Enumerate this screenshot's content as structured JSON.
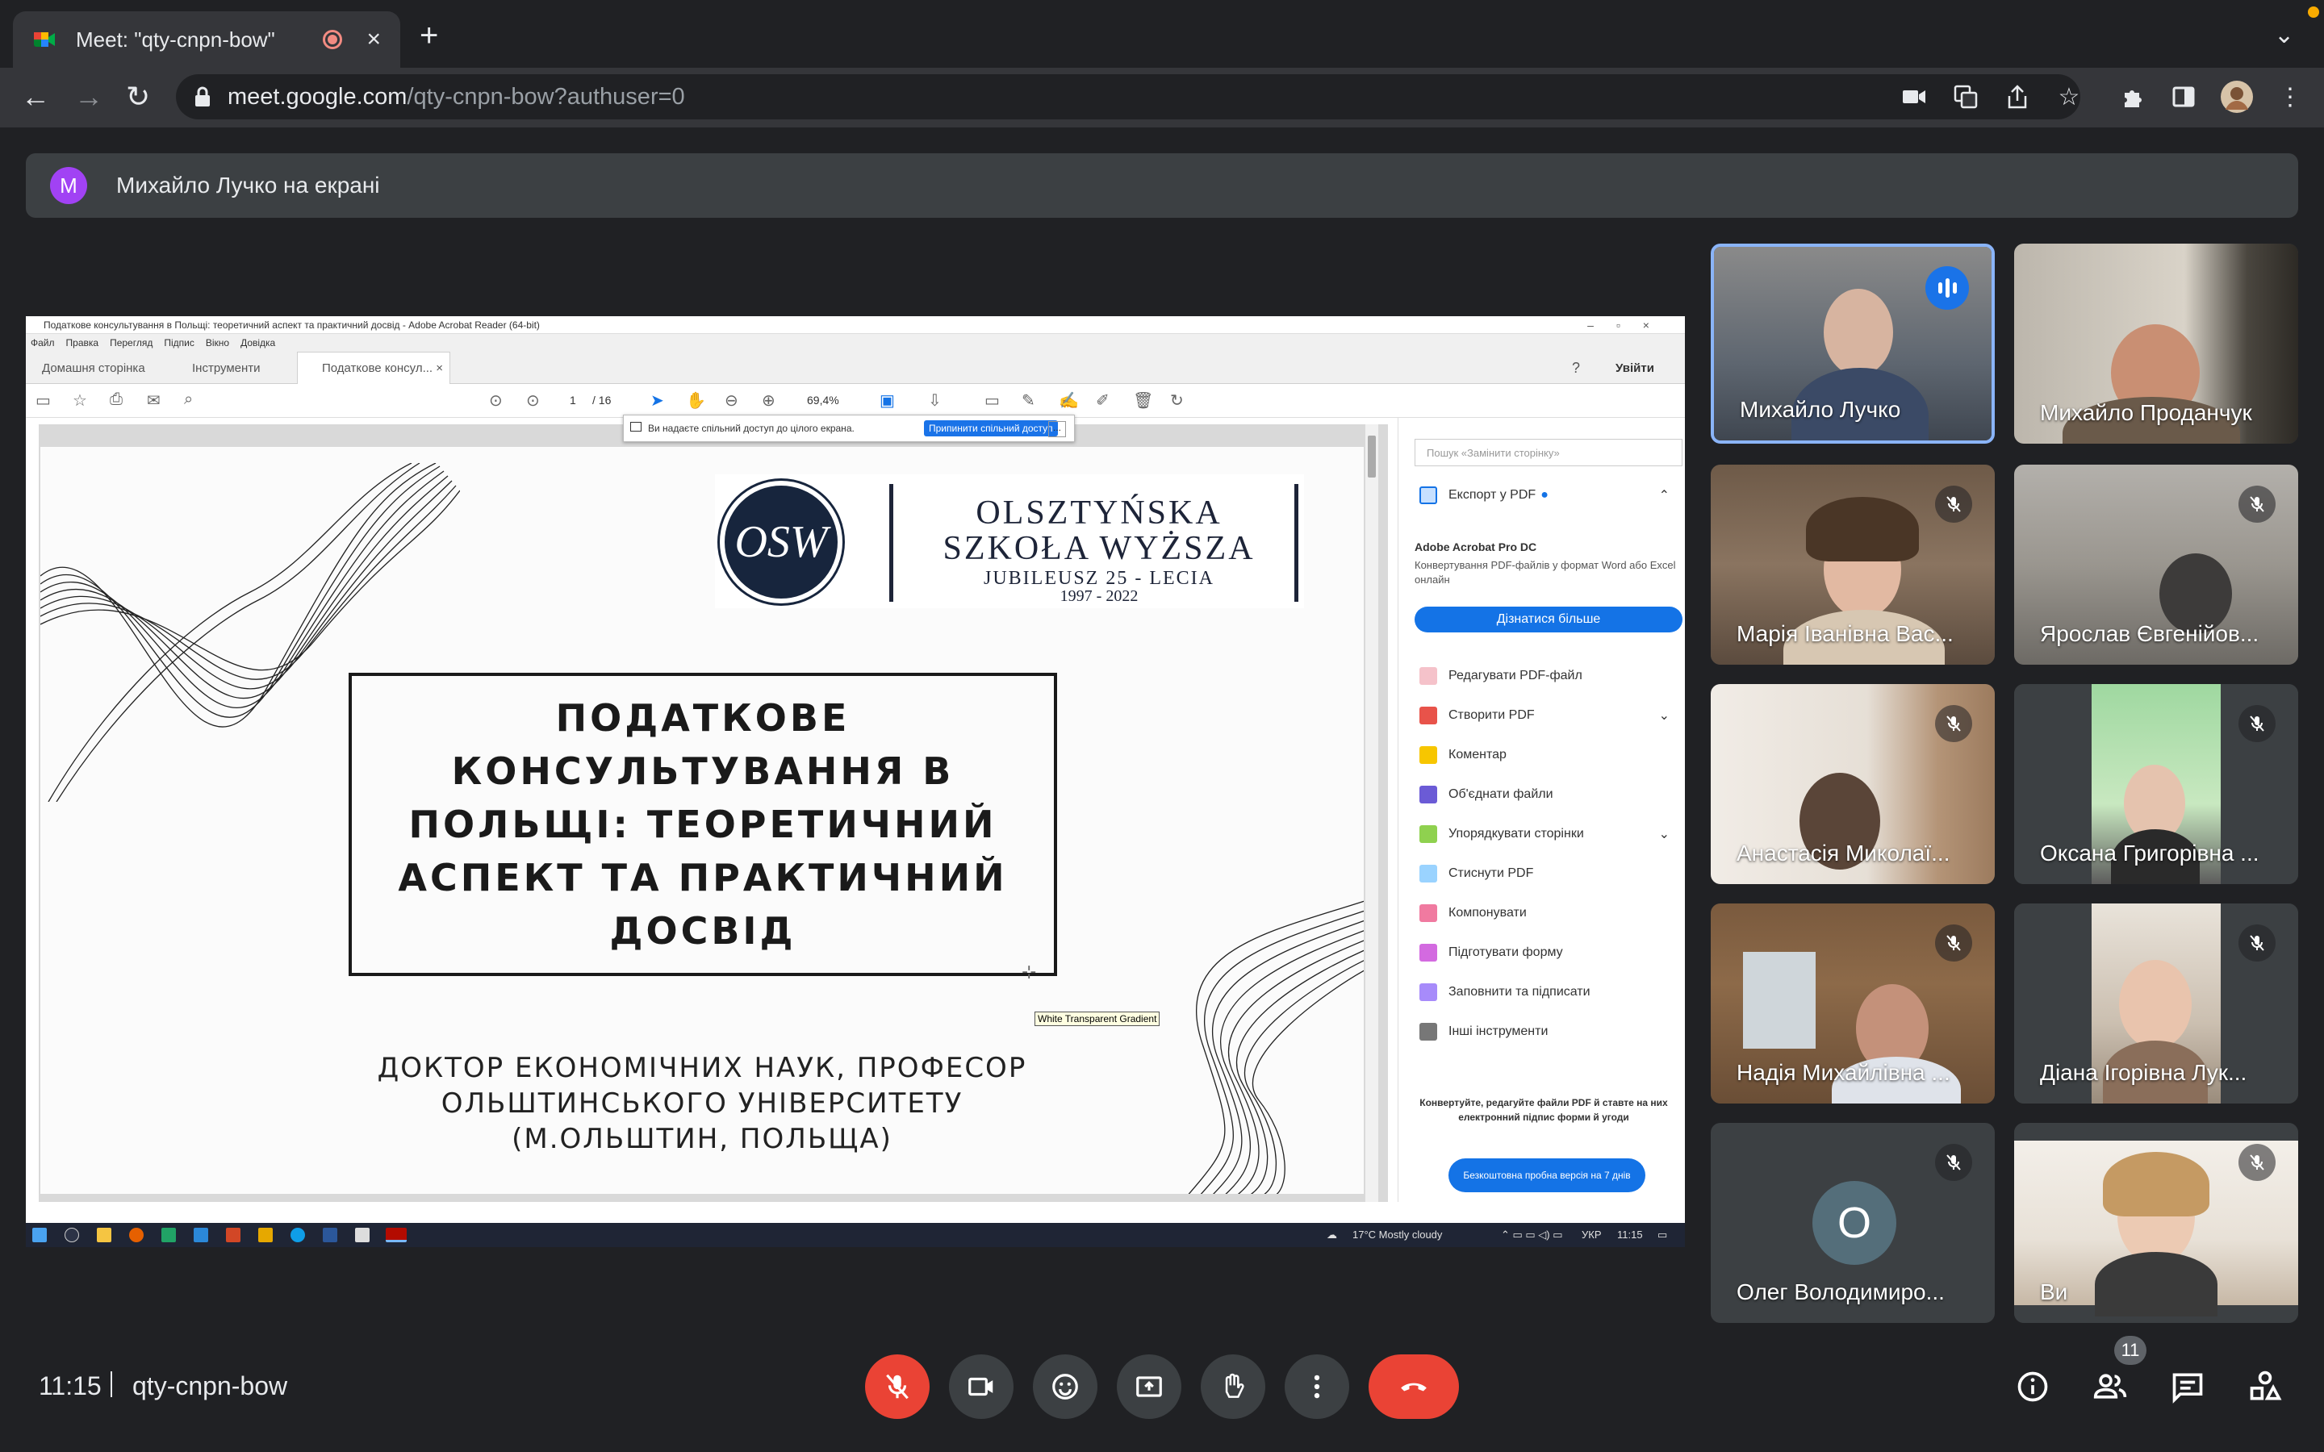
{
  "browser": {
    "tab_title": "Meet: \"qty-cnpn-bow\"",
    "new_tab": "+",
    "close": "×",
    "url_host": "meet.google.com",
    "url_path": "/qty-cnpn-bow?authuser=0",
    "back": "←",
    "forward": "→",
    "reload": "↻"
  },
  "banner": {
    "avatar_letter": "M",
    "text": "Михайло Лучко на екрані"
  },
  "acrobat": {
    "window_title": "Податкове консультування в Польщі: теоретичний аспект та практичний досвід - Adobe Acrobat Reader (64-bit)",
    "menu": [
      "Файл",
      "Правка",
      "Перегляд",
      "Підпис",
      "Вікно",
      "Довідка"
    ],
    "tabs": [
      "Домашня сторінка",
      "Інструменти",
      "Податкове консул..."
    ],
    "signin": "Увійти",
    "page_current": "1",
    "page_total": "/ 16",
    "zoom": "69,4%",
    "share_msg": "Ви надаєте спільний доступ до цілого екрана.",
    "share_stop": "Припинити спільний доступ",
    "share_more": "..."
  },
  "slide": {
    "logo_mark": "OSW",
    "logo_line1": "OLSZTYŃSKA",
    "logo_line2": "SZKOŁA WYŻSZA",
    "logo_line3": "JUBILEUSZ 25 - LECIA",
    "logo_line4": "1997 - 2022",
    "title": "ПОДАТКОВЕ КОНСУЛЬТУВАННЯ В ПОЛЬЩІ: ТЕОРЕТИЧНИЙ АСПЕКТ ТА ПРАКТИЧНИЙ ДОСВІД",
    "subtitle": "ДОКТОР ЕКОНОМІЧНИХ НАУК, ПРОФЕСОР ОЛЬШТИНСЬКОГО УНІВЕРСИТЕТУ (М.ОЛЬШТИН, ПОЛЬЩА)",
    "tooltip": "White Transparent Gradient"
  },
  "tools_panel": {
    "search_placeholder": "Пошук «Замінити сторінку»",
    "export": "Експорт у PDF",
    "pro_title": "Adobe Acrobat Pro DC",
    "pro_desc": "Конвертування PDF-файлів у формат Word або Excel онлайн",
    "learn_more": "Дізнатися більше",
    "tools": [
      "Редагувати PDF-файл",
      "Створити PDF",
      "Коментар",
      "Об'єднати файли",
      "Упорядкувати сторінки",
      "Стиснути PDF",
      "Компонувати",
      "Підготувати форму",
      "Заповнити та підписати",
      "Інші інструменти"
    ],
    "bottom_text": "Конвертуйте, редагуйте файли PDF й ставте на них електронний підпис форми й угоди",
    "trial": "Безкоштовна пробна версія на 7 днів"
  },
  "taskbar": {
    "weather": "17°C  Mostly cloudy",
    "lang": "УКР",
    "time": "11:15"
  },
  "participants": [
    {
      "name": "Михайло Лучко",
      "speaking": true
    },
    {
      "name": "Михайло Проданчук",
      "muted": false
    },
    {
      "name": "Марія Іванівна Вас...",
      "muted": true
    },
    {
      "name": "Ярослав Євгенійов...",
      "muted": true
    },
    {
      "name": "Анастасія Миколаї...",
      "muted": true
    },
    {
      "name": "Оксана Григорівна ...",
      "muted": true
    },
    {
      "name": "Надія Михайлівна ...",
      "muted": true
    },
    {
      "name": "Діана Ігорівна Лук...",
      "muted": true
    },
    {
      "name": "Олег Володимиро...",
      "muted": true,
      "avatar": "О"
    },
    {
      "name": "Ви",
      "muted": true
    }
  ],
  "controls": {
    "time": "11:15",
    "meeting_code": "qty-cnpn-bow",
    "participant_count": "11"
  },
  "colors": {
    "accent_blue": "#1a73e8",
    "end_red": "#ea4335",
    "meet_bg": "#202124"
  }
}
